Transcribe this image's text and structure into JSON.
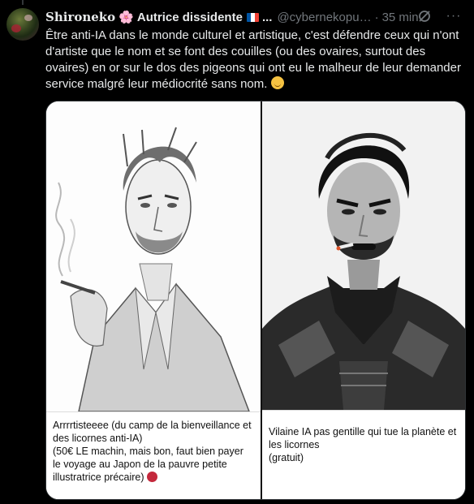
{
  "author": {
    "display_name": "Shironeko",
    "flower_emoji": "🌸",
    "subtitle": "Autrice dissidente",
    "flag": "🇫🇷",
    "ellipsis": "...",
    "handle": "@cybernekopu…",
    "separator": "·",
    "time": "35 min"
  },
  "icons": {
    "grok": "grok-icon",
    "more": "more-icon",
    "more_glyph": "···"
  },
  "tweet": {
    "text": "Être anti-IA dans le monde culturel et artistique, c'est défendre ceux qui n'ont d'artiste que le nom et se font des couilles (ou des ovaires, surtout des ovaires) en or sur le dos des pigeons qui ont eu le malheur de leur demander service malgré leur médiocrité sans nom.",
    "emoji": "😌"
  },
  "media": {
    "left_caption_line1": "Arrrrtisteeee (du camp de la bienveillance et des licornes anti-IA)",
    "left_caption_line2": "(50€ LE machin, mais bon, faut bien payer le voyage au Japon de la pauvre petite illustratrice précaire)",
    "left_caption_emoji": "🤡",
    "right_caption_line1": "Vilaine IA pas gentille qui tue la planète et les licornes",
    "right_caption_line2": "(gratuit)"
  },
  "colors": {
    "background": "#000000",
    "text": "#e7e9ea",
    "muted": "#71767b",
    "border": "#2f3336"
  }
}
